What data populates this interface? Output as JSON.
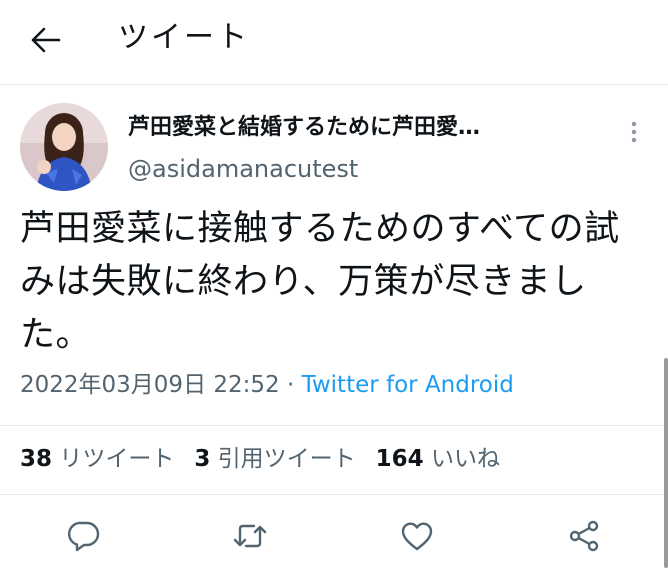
{
  "header": {
    "title": "ツイート",
    "back_icon": "arrow-left-icon"
  },
  "tweet": {
    "author": {
      "display_name": "芦田愛菜と結婚するために芦田愛…",
      "handle": "@asidamanacutest"
    },
    "text": "芦田愛菜に接触するためのすべての試みは失敗に終わり、万策が尽きました。",
    "timestamp": "2022年03月09日 22:52",
    "separator": " · ",
    "source": "Twitter for Android",
    "stats": {
      "retweets_count": "38",
      "retweets_label": "リツイート",
      "quotes_count": "3",
      "quotes_label": "引用ツイート",
      "likes_count": "164",
      "likes_label": "いいね"
    }
  },
  "actions": [
    "reply-icon",
    "retweet-icon",
    "like-icon",
    "share-icon"
  ],
  "colors": {
    "accent": "#1d9bf0",
    "text": "#0f1419",
    "secondary_text": "#536471",
    "divider": "#e6e6e6"
  }
}
